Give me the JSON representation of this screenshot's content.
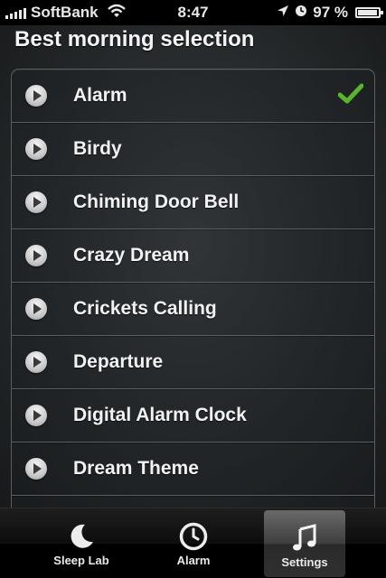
{
  "status_bar": {
    "carrier": "SoftBank",
    "time": "8:47",
    "battery_percent": "97 %",
    "battery_level": 0.97
  },
  "page": {
    "title": "Best morning selection"
  },
  "sounds": [
    {
      "label": "Alarm",
      "selected": true
    },
    {
      "label": "Birdy",
      "selected": false
    },
    {
      "label": "Chiming Door Bell",
      "selected": false
    },
    {
      "label": "Crazy Dream",
      "selected": false
    },
    {
      "label": "Crickets Calling",
      "selected": false
    },
    {
      "label": "Departure",
      "selected": false
    },
    {
      "label": "Digital Alarm Clock",
      "selected": false
    },
    {
      "label": "Dream Theme",
      "selected": false
    },
    {
      "label": "",
      "selected": false
    }
  ],
  "tabs": [
    {
      "label": "Sleep Lab",
      "icon": "moon-icon",
      "selected": false
    },
    {
      "label": "Alarm",
      "icon": "clock-icon",
      "selected": false
    },
    {
      "label": "Settings",
      "icon": "music-note-icon",
      "selected": true
    }
  ],
  "colors": {
    "checkmark": "#58b52a"
  }
}
